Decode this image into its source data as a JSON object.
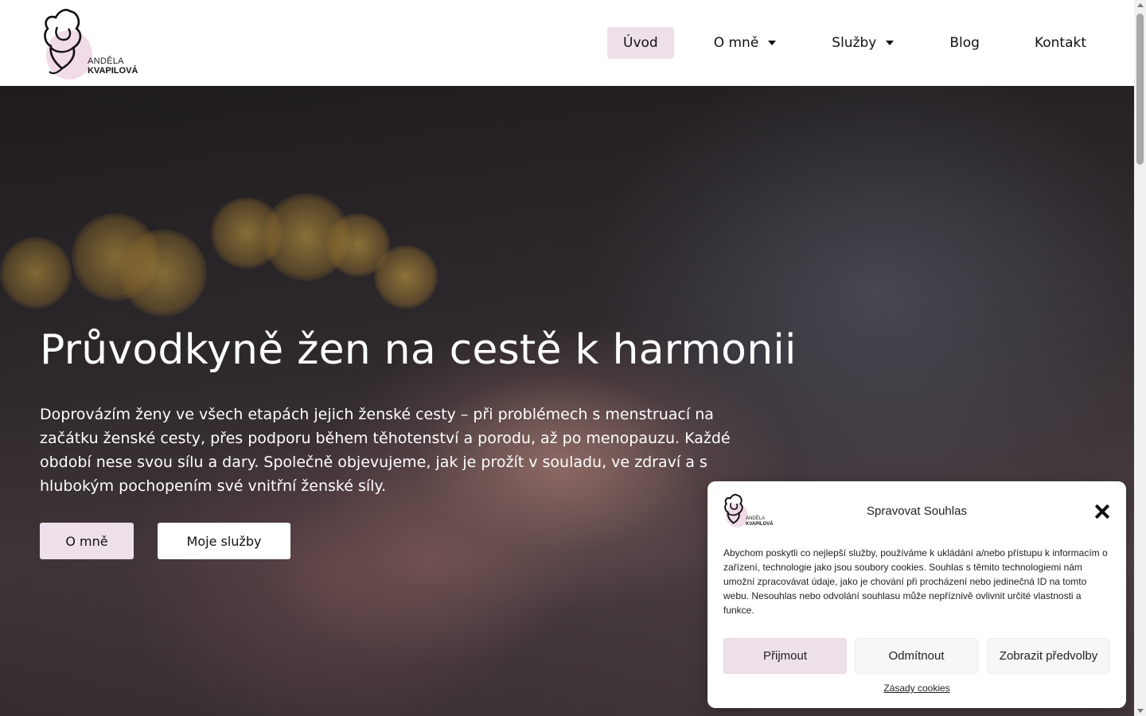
{
  "header": {
    "logo": {
      "line1": "ANDĚLA",
      "line2": "KVAPILOVÁ",
      "icon": "mother-child-logo-icon"
    },
    "nav": [
      {
        "label": "Úvod",
        "active": true,
        "dropdown": false
      },
      {
        "label": "O mně",
        "active": false,
        "dropdown": true
      },
      {
        "label": "Služby",
        "active": false,
        "dropdown": true
      },
      {
        "label": "Blog",
        "active": false,
        "dropdown": false
      },
      {
        "label": "Kontakt",
        "active": false,
        "dropdown": false
      }
    ]
  },
  "hero": {
    "title": "Průvodkyně žen na cestě k harmonii",
    "text": "Doprovázím ženy ve všech etapách jejich ženské cesty – při problémech s menstruací na začátku ženské cesty, přes podporu během těhotenství a porodu, až po menopauzu. Každé období nese svou sílu a dary. Společně objevujeme, jak je prožít v souladu, ve zdraví a s hlubokým pochopením své vnitřní ženské síly.",
    "buttons": {
      "about": "O mně",
      "services": "Moje služby"
    }
  },
  "cookie": {
    "title": "Spravovat Souhlas",
    "body": "Abychom poskytli co nejlepší služby, používáme k ukládání a/nebo přístupu k informacím o zařízení, technologie jako jsou soubory cookies. Souhlas s těmito technologiemi nám umožní zpracovávat údaje, jako je chování při procházení nebo jedinečná ID na tomto webu. Nesouhlas nebo odvolání souhlasu může nepříznivě ovlivnit určité vlastnosti a funkce.",
    "accept": "Přijmout",
    "deny": "Odmítnout",
    "preferences": "Zobrazit předvolby",
    "policy_link": "Zásady cookies"
  },
  "colors": {
    "accent": "#eee0ea",
    "logo_blob": "#f1dbe8"
  }
}
